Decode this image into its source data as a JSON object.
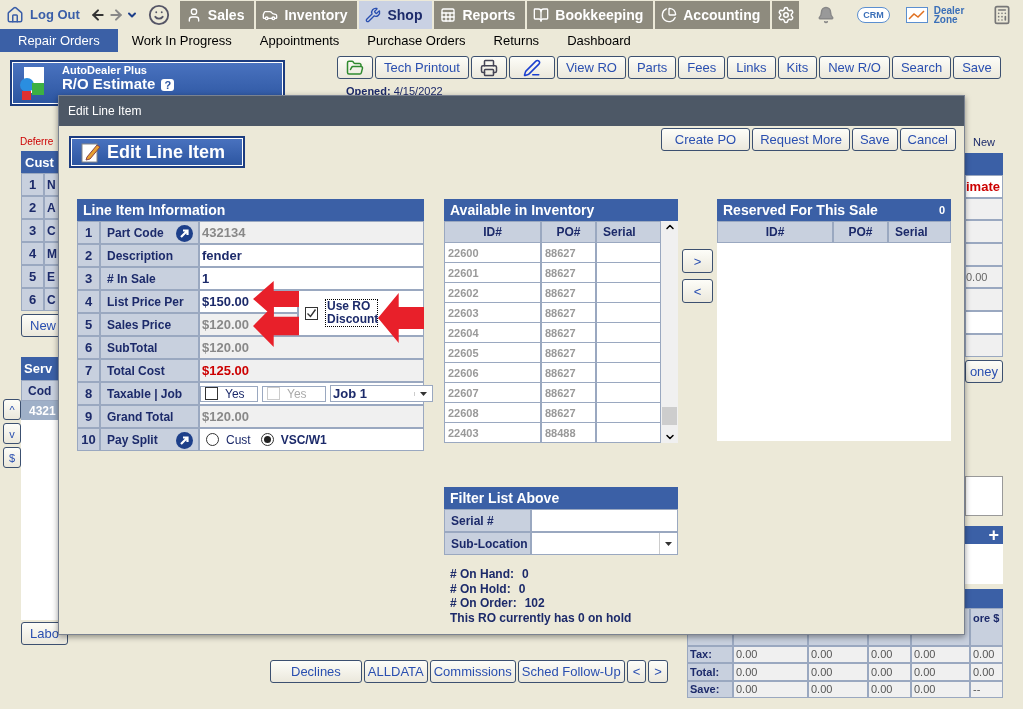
{
  "top_nav": {
    "logout": "Log Out",
    "tabs": [
      {
        "label": "Sales",
        "kind": "sales",
        "selected": false
      },
      {
        "label": "Inventory",
        "kind": "inventory",
        "selected": false
      },
      {
        "label": "Shop",
        "kind": "shop",
        "selected": true
      },
      {
        "label": "Reports",
        "kind": "reports",
        "selected": false
      },
      {
        "label": "Bookkeeping",
        "kind": "bookkeeping",
        "selected": false
      },
      {
        "label": "Accounting",
        "kind": "accounting",
        "selected": false
      }
    ],
    "crm": "CRM",
    "dealer_zone": "Dealer Zone"
  },
  "sub_nav": [
    {
      "label": "Repair Orders",
      "selected": true
    },
    {
      "label": "Work In Progress",
      "selected": false
    },
    {
      "label": "Appointments",
      "selected": false
    },
    {
      "label": "Purchase Orders",
      "selected": false
    },
    {
      "label": "Returns",
      "selected": false
    },
    {
      "label": "Dashboard",
      "selected": false
    }
  ],
  "logo": {
    "brand": "AutoDealer Plus",
    "title": "R/O Estimate",
    "help": "?"
  },
  "toolbar": [
    {
      "kind": "folder"
    },
    {
      "kind": "text",
      "label": "Tech Printout"
    },
    {
      "kind": "printer"
    },
    {
      "kind": "sign"
    },
    {
      "kind": "text",
      "label": "View RO"
    },
    {
      "kind": "text",
      "label": "Parts"
    },
    {
      "kind": "text",
      "label": "Fees"
    },
    {
      "kind": "text",
      "label": "Links"
    },
    {
      "kind": "text",
      "label": "Kits"
    },
    {
      "kind": "text",
      "label": "New R/O"
    },
    {
      "kind": "text",
      "label": "Search"
    },
    {
      "kind": "text",
      "label": "Save"
    }
  ],
  "opened": "**Opened:** 4/15/2022",
  "left": {
    "deferred": "Deferre",
    "customer_title": "Cust",
    "customer_rows": [
      {
        "num": "1",
        "label": "N"
      },
      {
        "num": "2",
        "label": "A"
      },
      {
        "num": "3",
        "label": "C"
      },
      {
        "num": "4",
        "label": "M"
      },
      {
        "num": "5",
        "label": "E"
      },
      {
        "num": "6",
        "label": "C"
      }
    ],
    "new_button": "New",
    "service_title": "Serv",
    "service_column": "Cod",
    "service_rows": [
      {
        "code": "4321",
        "selected": true
      }
    ],
    "side_buttons": [
      "^",
      "v",
      "$"
    ],
    "labor_button": "Labo"
  },
  "right": {
    "new_label": "New",
    "cells": [
      {
        "kind": "alert",
        "text": "imate"
      },
      {
        "kind": "blank"
      },
      {
        "kind": "blank"
      },
      {
        "kind": "blank"
      },
      {
        "kind": "amount",
        "text": "0.00"
      },
      {
        "kind": "blank"
      },
      {
        "kind": "input"
      },
      {
        "kind": "blank"
      }
    ],
    "money_button": "oney",
    "add_sign": "+",
    "totals": {
      "last_header": "ore $",
      "rows": [
        {
          "label": "Tax:",
          "values": [
            "0.00",
            "0.00",
            "0.00",
            "0.00",
            "0.00"
          ]
        },
        {
          "label": "Total:",
          "values": [
            "0.00",
            "0.00",
            "0.00",
            "0.00",
            "0.00"
          ]
        },
        {
          "label": "Save:",
          "values": [
            "0.00",
            "0.00",
            "0.00",
            "0.00",
            "--"
          ]
        }
      ]
    }
  },
  "bottom_buttons": [
    "Declines",
    "ALLDATA",
    "Commissions",
    "Sched Follow-Up",
    "<",
    ">"
  ],
  "modal": {
    "title": "Edit Line Item",
    "heading": "Edit Line Item",
    "actions": [
      "Create PO",
      "Request More",
      "Save",
      "Cancel"
    ],
    "line_item": {
      "title": "Line Item Information",
      "discount": {
        "label": "Use RO Discount",
        "checked": true
      },
      "rows": [
        {
          "num": "1",
          "label": "Part Code",
          "kind": "lookup",
          "value": "432134"
        },
        {
          "num": "2",
          "label": "Description",
          "kind": "input",
          "value": "fender"
        },
        {
          "num": "3",
          "label": "# In Sale",
          "kind": "input",
          "value": "1"
        },
        {
          "num": "4",
          "label": "List Price Per",
          "kind": "price",
          "value": "$150.00"
        },
        {
          "num": "5",
          "label": "Sales Price",
          "kind": "readonly",
          "value": "$120.00"
        },
        {
          "num": "6",
          "label": "SubTotal",
          "kind": "readonly",
          "value": "$120.00"
        },
        {
          "num": "7",
          "label": "Total Cost",
          "kind": "cost",
          "value": "$125.00"
        },
        {
          "num": "8",
          "label": "Taxable | Job",
          "kind": "taxjob",
          "taxable": {
            "label": "Yes",
            "checked": false
          },
          "job_taxable": {
            "label": "Yes",
            "checked": false,
            "disabled": true
          },
          "job": "Job 1"
        },
        {
          "num": "9",
          "label": "Grand Total",
          "kind": "readonly",
          "value": "$120.00"
        },
        {
          "num": "10",
          "label": "Pay Split",
          "kind": "split",
          "options": [
            {
              "label": "Cust",
              "selected": false
            },
            {
              "label": "VSC/W1",
              "selected": true
            }
          ]
        }
      ]
    },
    "inventory": {
      "title": "Available in Inventory",
      "columns": [
        "ID#",
        "PO#",
        "Serial"
      ],
      "rows": [
        {
          "id": "22600",
          "po": "88627"
        },
        {
          "id": "22601",
          "po": "88627"
        },
        {
          "id": "22602",
          "po": "88627"
        },
        {
          "id": "22603",
          "po": "88627"
        },
        {
          "id": "22604",
          "po": "88627"
        },
        {
          "id": "22605",
          "po": "88627"
        },
        {
          "id": "22606",
          "po": "88627"
        },
        {
          "id": "22607",
          "po": "88627"
        },
        {
          "id": "22608",
          "po": "88627"
        },
        {
          "id": "22403",
          "po": "88488"
        }
      ]
    },
    "move_buttons": [
      ">",
      "<"
    ],
    "reserved": {
      "title": "Reserved For This Sale",
      "count": "0",
      "columns": [
        "ID#",
        "PO#",
        "Serial"
      ]
    },
    "filter": {
      "title": "Filter List Above",
      "fields": [
        {
          "label": "Serial #",
          "kind": "text"
        },
        {
          "label": "Sub-Location",
          "kind": "select"
        }
      ]
    },
    "stats": [
      {
        "label": "# On Hand:",
        "value": "0"
      },
      {
        "label": "# On Hold:",
        "value": "0"
      },
      {
        "label": "# On Order:",
        "value": "102"
      }
    ],
    "hold_note": "This RO currently has 0 on hold"
  }
}
